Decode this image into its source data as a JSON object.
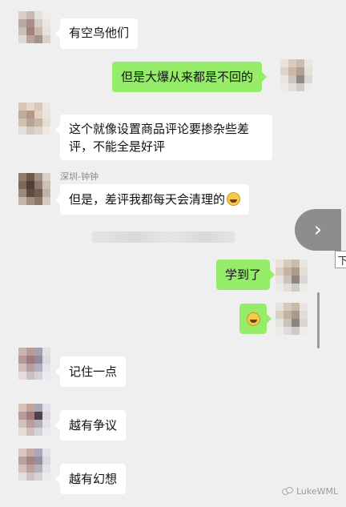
{
  "messages": [
    {
      "id": "m1",
      "dir": "in",
      "text": "有空鸟他们"
    },
    {
      "id": "m2",
      "dir": "out",
      "text": "但是大爆从来都是不回的"
    },
    {
      "id": "m3",
      "dir": "in",
      "text": "这个就像设置商品评论要掺杂些差评，不能全是好评"
    },
    {
      "id": "m4",
      "dir": "in",
      "sender": "深圳-钟钟",
      "text": "但是，差评我都每天会清理的",
      "emoji": "laugh-crying-emoji"
    },
    {
      "id": "m5",
      "dir": "out",
      "text": "学到了"
    },
    {
      "id": "m6",
      "dir": "out",
      "text": "",
      "emoji": "laugh-crying-emoji"
    },
    {
      "id": "m7",
      "dir": "in",
      "text": "记住一点"
    },
    {
      "id": "m8",
      "dir": "in",
      "text": "越有争议"
    },
    {
      "id": "m9",
      "dir": "in",
      "text": "越有幻想"
    }
  ],
  "next_button": {
    "glyph": "›"
  },
  "edge_tag": {
    "text": "下"
  },
  "watermark": {
    "text": "LukeWML"
  },
  "colors": {
    "background": "#efefef",
    "incoming_bubble": "#ffffff",
    "outgoing_bubble": "#95ec69"
  }
}
